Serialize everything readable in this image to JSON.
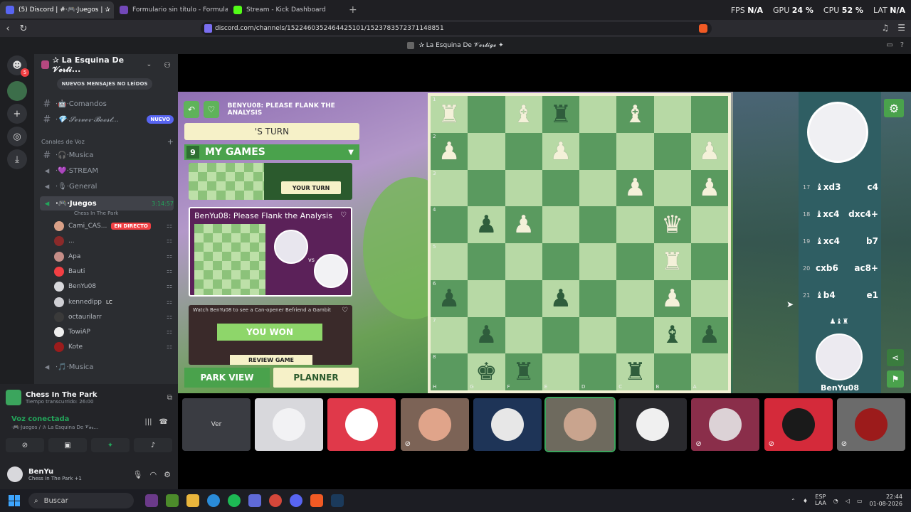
{
  "browser": {
    "tabs": [
      {
        "label": "(5) Discord | #⋅🎮⋅Juegos | ✰",
        "active": true
      },
      {
        "label": "Formulario sin título - Formularios de"
      },
      {
        "label": "Stream - Kick Dashboard"
      }
    ],
    "new_tab": "+",
    "url": "discord.com/channels/1522460352464425101/1523783572371148851",
    "stats": {
      "fps_label": "FPS",
      "fps": "N/A",
      "gpu_label": "GPU",
      "gpu": "24 %",
      "cpu_label": "CPU",
      "cpu": "52 %",
      "lat_label": "LAT",
      "lat": "N/A"
    }
  },
  "discord": {
    "window_title": "✰ La Esquina De 𝓥𝓮𝓻𝓽𝓲𝓰𝓮 ✦",
    "rail_badge": "5",
    "server_name": "✰ La Esquina De 𝓥𝓮𝓻𝓽𝓲...",
    "unread_label": "NUEVOS MENSAJES NO LEÍDOS",
    "channels": [
      {
        "label": "⋅🤖⋅Comandos"
      },
      {
        "label": "⋅💎⋅𝓢𝓮𝓻𝓿𝓮𝓻-𝓑𝓸𝓸𝓼𝓽...",
        "badge": "NUEVO"
      }
    ],
    "voice_category": "Canales de Voz",
    "voice_channels": [
      {
        "label": "⋅🎧⋅Musica"
      },
      {
        "label": "⋅💜⋅STREAM"
      },
      {
        "label": "⋅🎙⋅General"
      },
      {
        "label": "⋅🎮⋅Juegos",
        "time": "3:14:57",
        "sub": "Chess In The Park"
      },
      {
        "label": "⋅🎵⋅Musica"
      }
    ],
    "members": [
      {
        "name": "Cami_CAS...",
        "live": "EN DIRECTO",
        "color": "#d9a087"
      },
      {
        "name": "...",
        "color": "#8b2a2a"
      },
      {
        "name": "Apa",
        "color": "#c58d87"
      },
      {
        "name": "Bauti",
        "color": "#f23f43"
      },
      {
        "name": "BenYu08",
        "color": "#d8d8dc"
      },
      {
        "name": "kennedipp",
        "extra": "LC",
        "color": "#cfcfd4"
      },
      {
        "name": "octaurilarr",
        "color": "#3a3a3a"
      },
      {
        "name": "TowiAP",
        "color": "#eeeeee"
      },
      {
        "name": "Kote",
        "color": "#9b1c1c"
      }
    ],
    "activity": {
      "title": "Chess In The Park",
      "subtitle": "Tiempo transcurrido: 26:00"
    },
    "voice": {
      "status": "Voz conectada",
      "location": "⋅🎮⋅Juegos / ✰ La Esquina De 𝓥𝓮𝓻..."
    },
    "user": {
      "name": "BenYu",
      "status": "Chess In The Park +1"
    }
  },
  "game": {
    "header": "BENYU08: PLEASE FLANK THE ANALYSIS",
    "turn_text": "'S TURN",
    "my_games_count": "9",
    "my_games_label": "MY GAMES",
    "your_turn": "YOUR TURN",
    "card_title": "BenYu08: Please Flank the Analysis",
    "vs": "vs",
    "won_card_title": "Watch BenYu08 to see a Can-opener Befriend a Gambit",
    "you_won": "YOU WON",
    "review": "REVIEW GAME",
    "park_view": "PARK VIEW",
    "planner": "PLANNER",
    "ranks": [
      "1",
      "2",
      "3",
      "4",
      "5",
      "6",
      "7",
      "8"
    ],
    "files": [
      "H",
      "G",
      "F",
      "E",
      "D",
      "C",
      "B",
      "A"
    ],
    "board": [
      [
        "wR",
        "",
        "wB",
        "bR",
        "",
        "wB",
        "",
        ""
      ],
      [
        "wP",
        "",
        "",
        "wP",
        "",
        "",
        "",
        "wP"
      ],
      [
        "",
        "",
        "",
        "",
        "",
        "wP",
        "",
        "wP"
      ],
      [
        "",
        "bP",
        "wP",
        "",
        "",
        "",
        "wQ",
        ""
      ],
      [
        "",
        "",
        "",
        "",
        "",
        "",
        "wR",
        ""
      ],
      [
        "bP",
        "",
        "",
        "bP",
        "",
        "",
        "wP",
        ""
      ],
      [
        "",
        "bP",
        "",
        "",
        "",
        "",
        "bB",
        "bP"
      ],
      [
        "",
        "bK",
        "bR",
        "",
        "",
        "bR",
        "",
        ""
      ]
    ],
    "moves": [
      {
        "n": "17",
        "w": "♝xd3",
        "b": "c4"
      },
      {
        "n": "18",
        "w": "♝xc4",
        "b": "dxc4+"
      },
      {
        "n": "19",
        "w": "♝xc4",
        "b": "b7"
      },
      {
        "n": "20",
        "w": "cxb6",
        "b": "ac8+"
      },
      {
        "n": "21",
        "w": "♝b4",
        "b": "e1"
      }
    ],
    "bottom_player": "BenYu08"
  },
  "tiles": [
    {
      "kind": "text",
      "label": "Ver",
      "bg": "#3a3c42"
    },
    {
      "kind": "avatar",
      "bg": "#d8d8dc",
      "av": "#f2f2f4"
    },
    {
      "kind": "avatar",
      "bg": "#e0394a",
      "av": "#ffffff"
    },
    {
      "kind": "avatar",
      "bg": "#7c6356",
      "av": "#e0a48a",
      "muted": true
    },
    {
      "kind": "avatar",
      "bg": "#1e3457",
      "av": "#e7e7e7"
    },
    {
      "kind": "avatar",
      "bg": "#6e6a5e",
      "av": "#c9a48e"
    },
    {
      "kind": "avatar",
      "bg": "#2a2a2e",
      "av": "#f0f0f0"
    },
    {
      "kind": "avatar",
      "bg": "#8a2e4a",
      "av": "#dcd2d6",
      "muted": true
    },
    {
      "kind": "avatar",
      "bg": "#d42a3a",
      "av": "#1a1a1a",
      "muted": true
    },
    {
      "kind": "avatar",
      "bg": "#6b6b6b",
      "av": "#9c1b1b",
      "muted": true
    }
  ],
  "taskbar": {
    "search": "Buscar",
    "lang1": "ESP",
    "lang2": "LAA",
    "time": "22:44",
    "date": "01-08-2026"
  }
}
